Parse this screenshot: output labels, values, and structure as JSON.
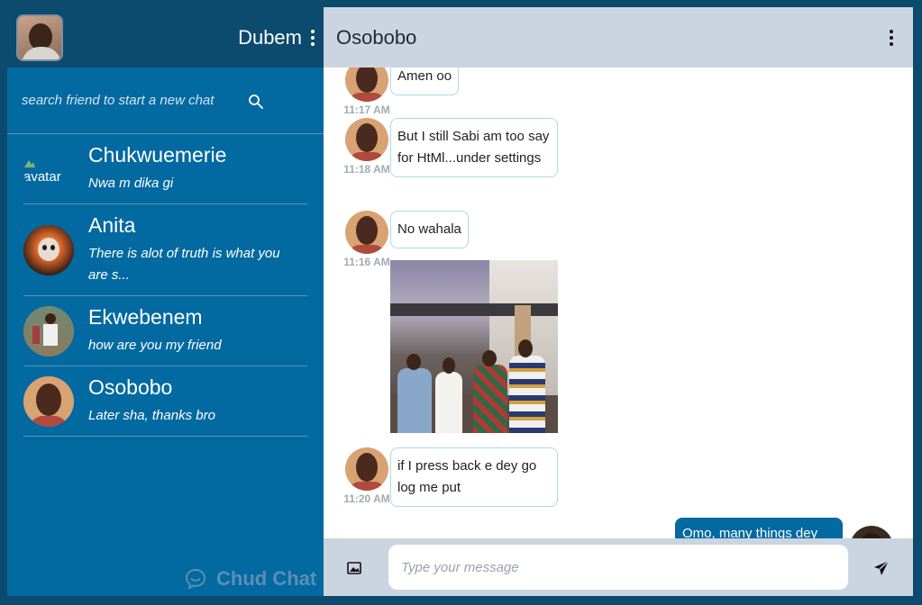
{
  "sidebar": {
    "user_name": "Dubem",
    "search_placeholder": "search friend to start a new chat",
    "contacts": [
      {
        "name": "Chukwuemerie",
        "preview": "Nwa m dika gi",
        "avatar_alt": "avatar"
      },
      {
        "name": "Anita",
        "preview": "There is alot of truth is what you are s..."
      },
      {
        "name": "Ekwebenem",
        "preview": "how are you my friend"
      },
      {
        "name": "Osobobo",
        "preview": "Later sha, thanks bro"
      }
    ],
    "brand": "Chud Chat"
  },
  "chat": {
    "title": "Osobobo",
    "messages": [
      {
        "text": "Amen oo",
        "time": "11:17 AM"
      },
      {
        "text": "But I still Sabi am too say for HtMl...under settings",
        "time": "11:18 AM"
      },
      {
        "text": "No wahala",
        "time": "11:16 AM"
      },
      {
        "type": "image"
      },
      {
        "text": "if I press back e dey go log me put",
        "time": "11:20 AM"
      }
    ],
    "outgoing": {
      "text": "Omo, many things dey"
    },
    "composer_placeholder": "Type your message"
  },
  "colors": {
    "sidebar_bg": "#0369a1",
    "header_bg": "#0c4a6e",
    "chat_header_bg": "#cbd5e1",
    "bubble_border": "#a9dbe7"
  },
  "icons": [
    "kebab-menu-icon",
    "search-icon",
    "chat-bubble-icon",
    "image-icon",
    "send-icon"
  ]
}
